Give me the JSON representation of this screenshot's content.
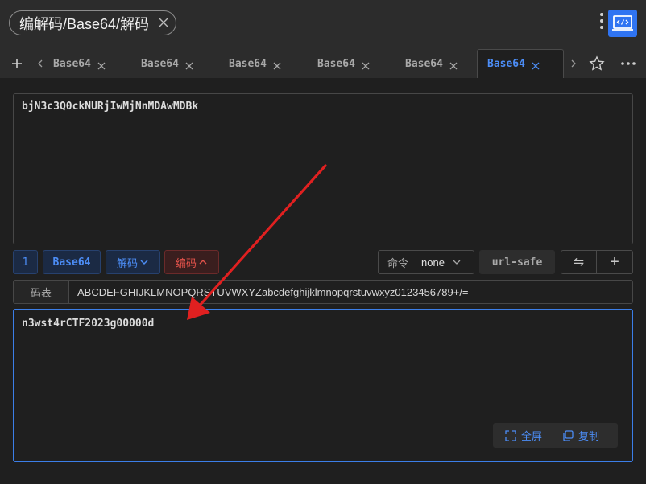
{
  "window": {
    "title": "编解码/Base64/解码"
  },
  "tabs": [
    {
      "label": "Base64",
      "active": false
    },
    {
      "label": "Base64",
      "active": false
    },
    {
      "label": "Base64",
      "active": false
    },
    {
      "label": "Base64",
      "active": false
    },
    {
      "label": "Base64",
      "active": false
    },
    {
      "label": "Base64",
      "active": true
    }
  ],
  "input": {
    "value": "bjN3c3Q0ckNURjIwMjNnMDAwMDBk"
  },
  "toolbar": {
    "line_count": "1",
    "encoding_label": "Base64",
    "decode_label": "解码",
    "encode_label": "编码",
    "command_label": "命令",
    "command_value": "none",
    "url_safe_label": "url-safe",
    "swap_icon": "⇋",
    "add_icon": "+"
  },
  "code_table": {
    "label": "码表",
    "value": "ABCDEFGHIJKLMNOPQRSTUVWXYZabcdefghijklmnopqrstuvwxyz0123456789+/="
  },
  "output": {
    "value": "n3wst4rCTF2023g00000d",
    "fullscreen_label": "全屏",
    "copy_label": "复制"
  },
  "colors": {
    "accent": "#4c8df6",
    "danger": "#e5534b",
    "annotation_arrow": "#e02020"
  },
  "icons": [
    "close-icon",
    "kebab-menu-icon",
    "code-icon",
    "plus-icon",
    "chevron-left-icon",
    "chevron-right-icon",
    "star-icon",
    "more-icon",
    "chevron-down-icon",
    "chevron-up-icon",
    "fullscreen-icon",
    "copy-icon"
  ]
}
